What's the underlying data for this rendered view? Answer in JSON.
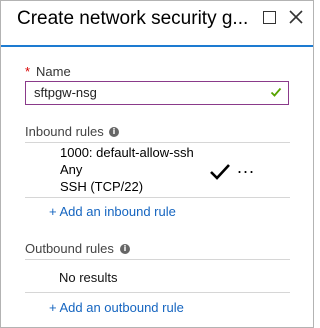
{
  "blade": {
    "title": "Create network security g...",
    "maximize_icon": "maximize-icon",
    "close_icon": "close-icon"
  },
  "name_field": {
    "required_marker": "*",
    "label": "Name",
    "value": "sftpgw-nsg",
    "valid_icon": "checkmark-icon",
    "valid_color": "#57a300",
    "border_color": "#8a3a8a"
  },
  "inbound": {
    "label": "Inbound rules",
    "info_icon": "i",
    "rules": [
      {
        "priority_name": "1000: default-allow-ssh",
        "source": "Any",
        "service": "SSH (TCP/22)",
        "status_icon": "checkmark-icon",
        "more": "..."
      }
    ],
    "add_link": "+ Add an inbound rule"
  },
  "outbound": {
    "label": "Outbound rules",
    "info_icon": "i",
    "empty_text": "No results",
    "add_link": "+ Add an outbound rule"
  },
  "colors": {
    "accent": "#1d7bd1",
    "link": "#1565c0",
    "required": "#d80000"
  }
}
